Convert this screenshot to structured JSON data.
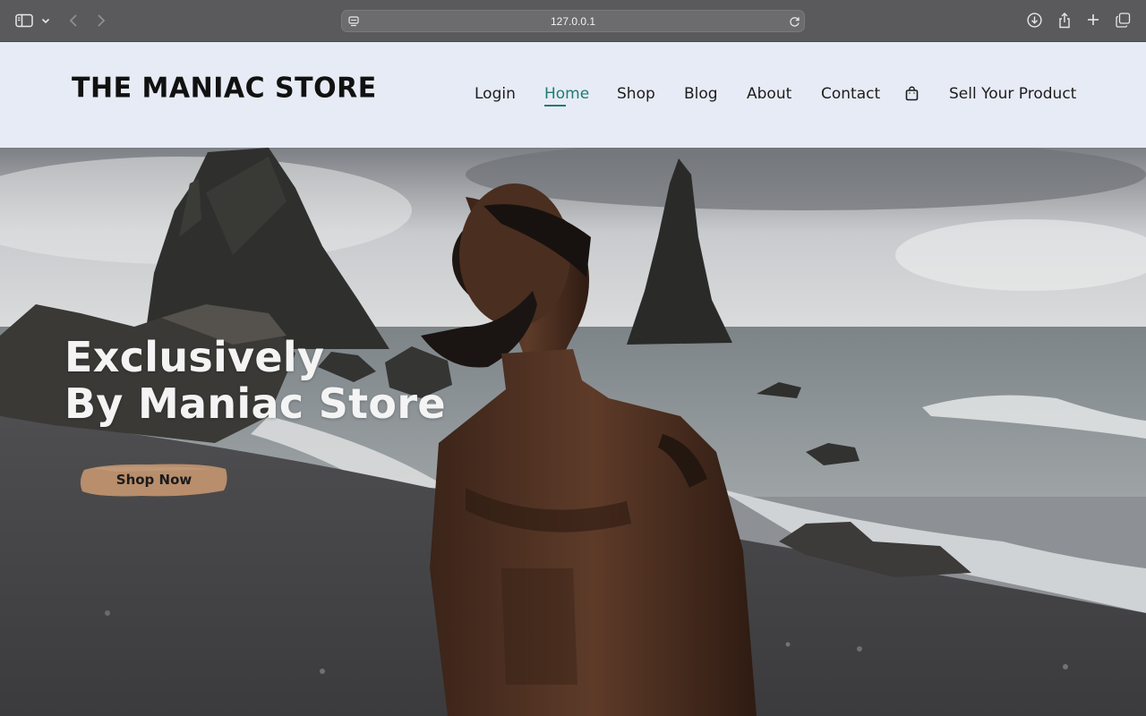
{
  "browser": {
    "url": "127.0.0.1",
    "icons": [
      "sidebar-toggle-icon",
      "chevron-down-icon",
      "back-icon",
      "forward-icon",
      "site-settings-icon",
      "reload-icon",
      "download-icon",
      "share-icon",
      "new-tab-icon",
      "tabs-overview-icon"
    ]
  },
  "header": {
    "logo": "THE MANIAC STORE",
    "nav": [
      {
        "label": "Login",
        "active": false
      },
      {
        "label": "Home",
        "active": true
      },
      {
        "label": "Shop",
        "active": false
      },
      {
        "label": "Blog",
        "active": false
      },
      {
        "label": "About",
        "active": false
      },
      {
        "label": "Contact",
        "active": false
      },
      {
        "label": "Sell Your Product",
        "active": false
      }
    ],
    "cart_icon": "shopping-bag-icon",
    "accent_color": "#1f7a74"
  },
  "hero": {
    "title_line1": "Exclusively",
    "title_line2": "By Maniac Store",
    "cta_label": "Shop Now",
    "cta_color": "#b88e6c"
  }
}
